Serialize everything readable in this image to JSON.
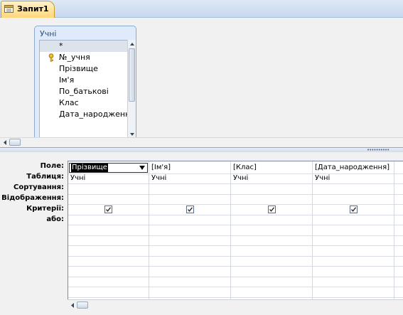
{
  "tab": {
    "label": "Запит1"
  },
  "table_box": {
    "title": "Учні",
    "fields": [
      "*",
      "№_учня",
      "Прізвище",
      "Ім'я",
      "По_батькові",
      "Клас",
      "Дата_народження"
    ]
  },
  "row_labels": [
    "Поле:",
    "Таблиця:",
    "Сортування:",
    "Відображення:",
    "Критерії:",
    "або:"
  ],
  "columns": [
    {
      "field": "Прізвище",
      "table": "Учні",
      "show": true
    },
    {
      "field": "[Ім'я]",
      "table": "Учні",
      "show": true
    },
    {
      "field": "[Клас]",
      "table": "Учні",
      "show": true
    },
    {
      "field": "[Дата_народження]",
      "table": "Учні",
      "show": true
    }
  ]
}
